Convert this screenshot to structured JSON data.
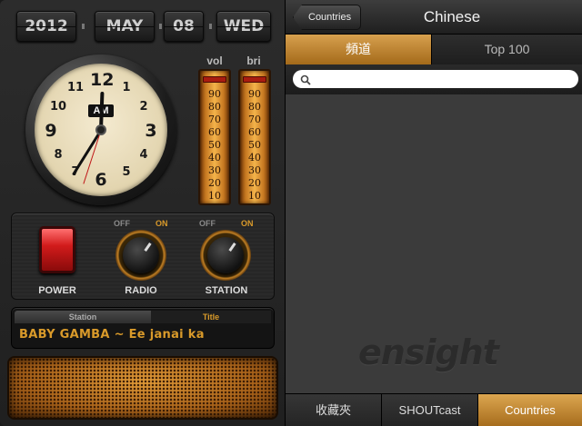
{
  "radio": {
    "date": {
      "year": "2012",
      "month": "MAY",
      "day": "08",
      "weekday": "WED"
    },
    "clock": {
      "numbers": [
        "12",
        "1",
        "2",
        "3",
        "4",
        "5",
        "6",
        "7",
        "8",
        "9",
        "10",
        "11"
      ],
      "ampm": "AM"
    },
    "meters": {
      "vol": {
        "label": "vol",
        "level": 0.95,
        "ticks": [
          "90",
          "80",
          "70",
          "60",
          "50",
          "40",
          "30",
          "20",
          "10"
        ]
      },
      "bri": {
        "label": "bri",
        "level": 0.95,
        "ticks": [
          "90",
          "80",
          "70",
          "60",
          "50",
          "40",
          "30",
          "20",
          "10"
        ]
      }
    },
    "controls": {
      "power_label": "POWER",
      "radio_label": "RADIO",
      "station_label": "STATION",
      "off_label": "OFF",
      "on_label": "ON"
    },
    "display": {
      "station_tab": "Station",
      "title_tab": "Title",
      "now_playing": "BABY GAMBA ~ Ee janai ka"
    }
  },
  "browser": {
    "nav": {
      "back_label": "Countries",
      "title": "Chinese"
    },
    "segments": {
      "active": "頻道",
      "inactive": "Top 100"
    },
    "search": {
      "placeholder": "",
      "value": ""
    },
    "logo_text": "ensight",
    "tabs": [
      {
        "label": "收藏夾",
        "active": false
      },
      {
        "label": "SHOUTcast",
        "active": false
      },
      {
        "label": "Countries",
        "active": true
      }
    ]
  },
  "colors": {
    "accent": "#c8893a",
    "display_text": "#d99a2a",
    "power_red": "#d21b1b"
  }
}
